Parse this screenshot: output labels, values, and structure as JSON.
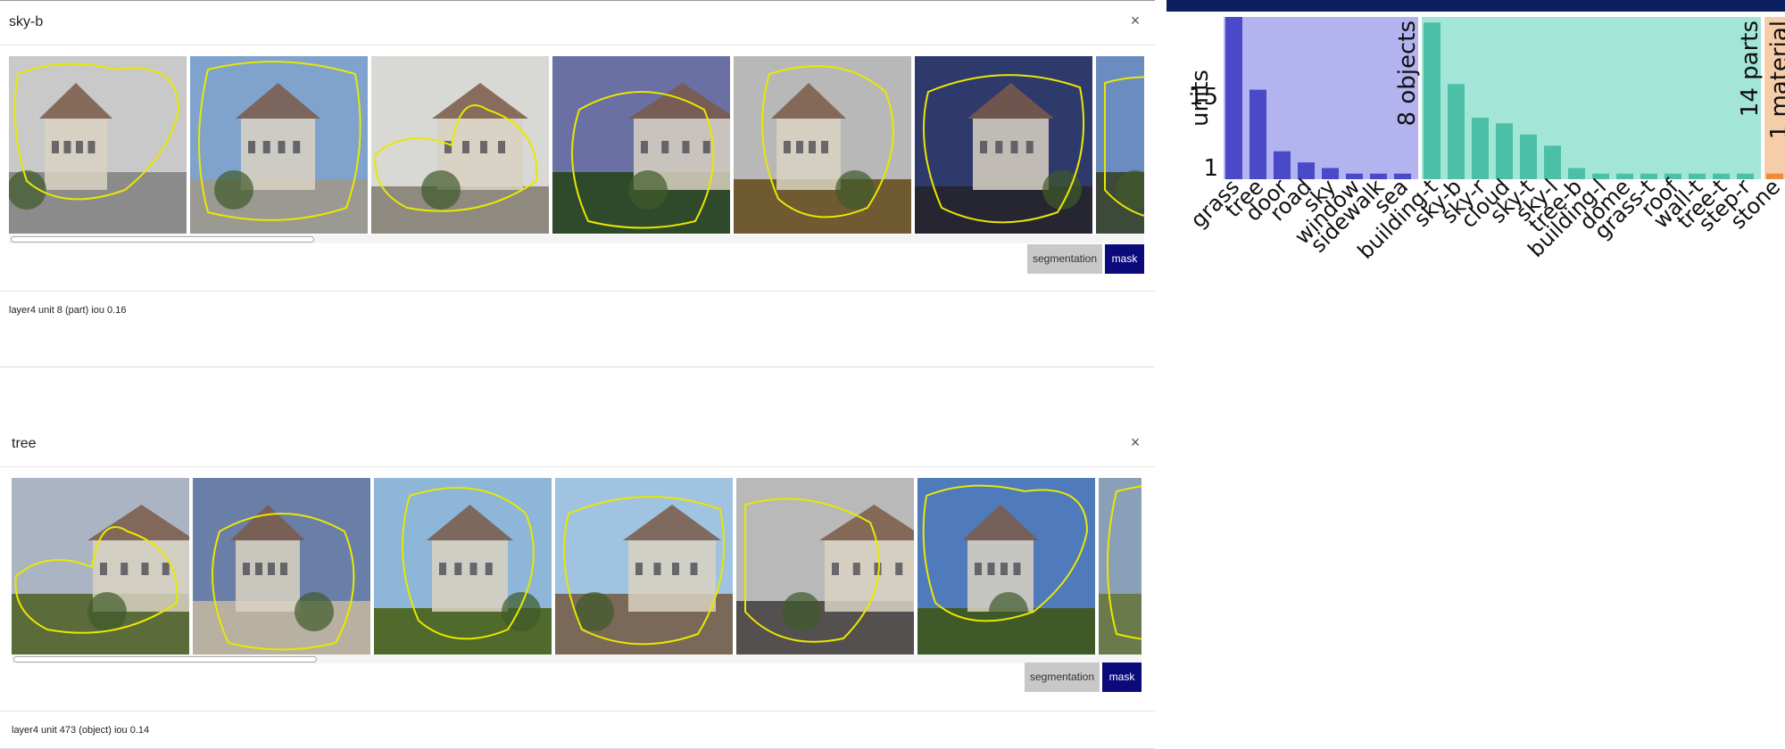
{
  "modals": [
    {
      "title": "sky-b",
      "close_label": "×",
      "buttons": {
        "segmentation": "segmentation",
        "mask": "mask"
      },
      "caption": "layer4 unit 8 (part) iou 0.16",
      "thumbs": [
        {
          "scene": "harbor",
          "sky": "#c9c9c9",
          "ground": "#8b8b8b"
        },
        {
          "scene": "church",
          "sky": "#7fa3cc",
          "ground": "#9a9a92"
        },
        {
          "scene": "town",
          "sky": "#d8d8d4",
          "ground": "#8e8a80"
        },
        {
          "scene": "tower",
          "sky": "#6a6fa4",
          "ground": "#2e4a2a"
        },
        {
          "scene": "house",
          "sky": "#b8b8b8",
          "ground": "#6f5a32"
        },
        {
          "scene": "dome",
          "sky": "#2f3a6c",
          "ground": "#262633"
        },
        {
          "scene": "partial",
          "sky": "#6b8cc0",
          "ground": "#3d4a3a"
        }
      ]
    },
    {
      "title": "tree",
      "close_label": "×",
      "buttons": {
        "segmentation": "segmentation",
        "mask": "mask"
      },
      "caption": "layer4 unit 473 (object) iou 0.14",
      "thumbs": [
        {
          "scene": "castle",
          "sky": "#aab4c2",
          "ground": "#5b6b3a"
        },
        {
          "scene": "palace",
          "sky": "#6a7fa8",
          "ground": "#b8b0a0"
        },
        {
          "scene": "monastery",
          "sky": "#8eb6d8",
          "ground": "#4f6a2a"
        },
        {
          "scene": "street",
          "sky": "#9fc3e0",
          "ground": "#7a6858"
        },
        {
          "scene": "gothic",
          "sky": "#b9b9b9",
          "ground": "#555050"
        },
        {
          "scene": "villa",
          "sky": "#4f7bbd",
          "ground": "#3f5a28"
        },
        {
          "scene": "partial",
          "sky": "#8aa0b8",
          "ground": "#6a7a4a"
        }
      ]
    }
  ],
  "chart_data": {
    "type": "bar",
    "ylabel": "units",
    "yticks": [
      "1",
      "15"
    ],
    "groups": [
      {
        "name": "8 objects",
        "bg": "#b3b3ef",
        "bar": "#4a4ac8",
        "categories": [
          "grass",
          "tree",
          "door",
          "road",
          "sky",
          "window",
          "sidewalk",
          "sea"
        ],
        "values": [
          29,
          16,
          5,
          3,
          2,
          1,
          1,
          1
        ]
      },
      {
        "name": "14 parts",
        "bg": "#a3e6d8",
        "bar": "#4cc0a6",
        "categories": [
          "building-t",
          "sky-b",
          "sky-r",
          "cloud",
          "sky-t",
          "sky-l",
          "tree-b",
          "building-l",
          "dome",
          "grass-t",
          "roof",
          "wall-t",
          "tree-t",
          "step-r"
        ],
        "values": [
          28,
          17,
          11,
          10,
          8,
          6,
          2,
          1,
          1,
          1,
          1,
          1,
          1,
          1
        ]
      },
      {
        "name": "1 material",
        "bg": "#f5cda8",
        "bar": "#ef8a3c",
        "categories": [
          "stone"
        ],
        "values": [
          1
        ]
      }
    ],
    "ymax": 29
  }
}
